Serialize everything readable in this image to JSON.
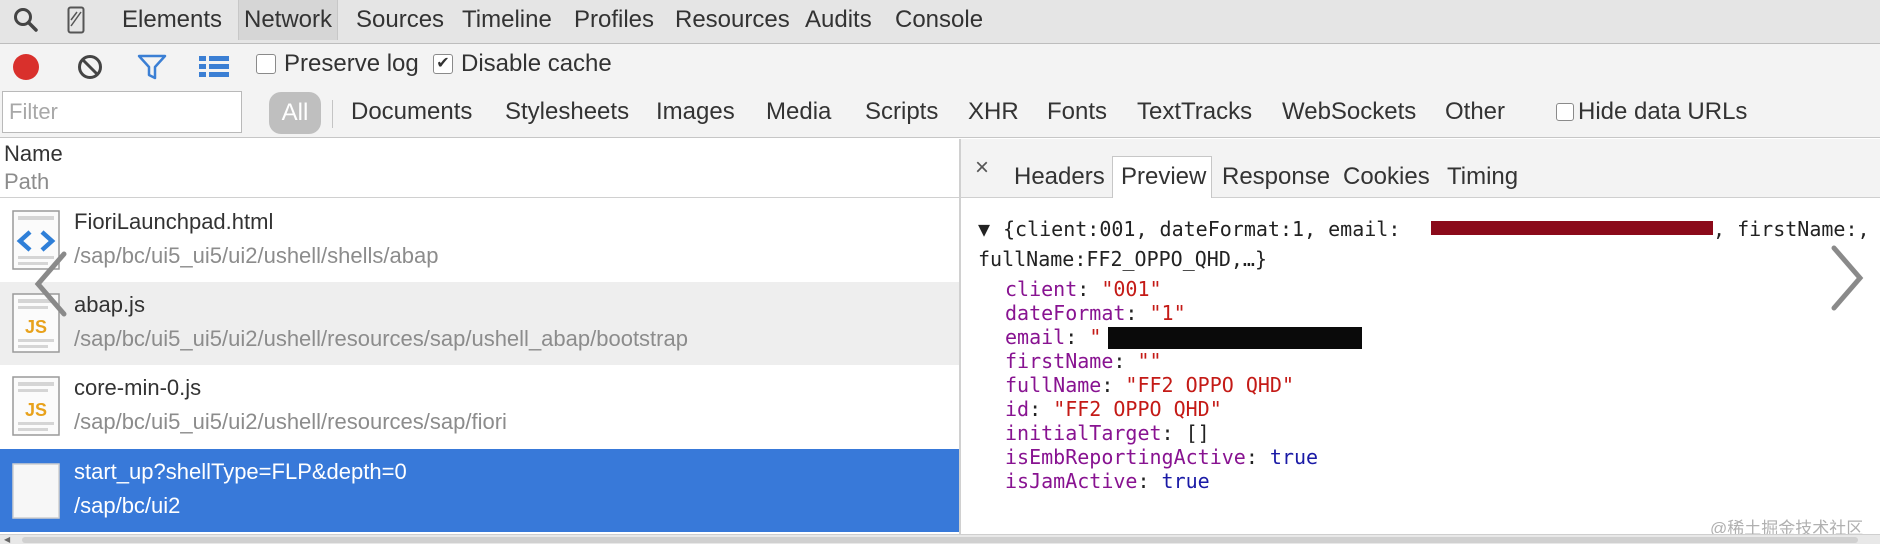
{
  "toolbar": {
    "search_icon": "search-icon",
    "device_icon": "device-mode-icon",
    "tabs": [
      "Elements",
      "Network",
      "Sources",
      "Timeline",
      "Profiles",
      "Resources",
      "Audits",
      "Console"
    ],
    "active_tab": "Network"
  },
  "network_toolbar": {
    "record_icon": "record-icon",
    "clear_icon": "clear-icon",
    "filter_icon": "filter-icon",
    "view_icon": "list-view-icon",
    "preserve_log": {
      "label": "Preserve log",
      "checked": false
    },
    "disable_cache": {
      "label": "Disable cache",
      "checked": true
    }
  },
  "filter_bar": {
    "placeholder": "Filter",
    "all_label": "All",
    "types": [
      "Documents",
      "Stylesheets",
      "Images",
      "Media",
      "Scripts",
      "XHR",
      "Fonts",
      "TextTracks",
      "WebSockets",
      "Other"
    ],
    "hide_data_urls": {
      "label": "Hide data URLs",
      "checked": false
    }
  },
  "request_list": {
    "header_name": "Name",
    "header_path": "Path",
    "rows": [
      {
        "name": "FioriLaunchpad.html",
        "path": "/sap/bc/ui5_ui5/ui2/ushell/shells/abap",
        "icon": "html-file-icon"
      },
      {
        "name": "abap.js",
        "path": "/sap/bc/ui5_ui5/ui2/ushell/resources/sap/ushell_abap/bootstrap",
        "icon": "js-file-icon"
      },
      {
        "name": "core-min-0.js",
        "path": "/sap/bc/ui5_ui5/ui2/ushell/resources/sap/fiori",
        "icon": "js-file-icon"
      },
      {
        "name": "start_up?shellType=FLP&depth=0",
        "path": "/sap/bc/ui2",
        "icon": "blank-file-icon",
        "selected": true
      }
    ]
  },
  "detail": {
    "close_label": "×",
    "tabs": [
      "Headers",
      "Preview",
      "Response",
      "Cookies",
      "Timing"
    ],
    "active_tab": "Preview",
    "preview": {
      "summary_line_1a": "{client:001, dateFormat:1, email:",
      "summary_line_1b": ", firstName:,",
      "summary_line_2": "fullName:FF2_OPPO_QHD,…}",
      "props": [
        {
          "key": "client",
          "value": "\"001\"",
          "kind": "string"
        },
        {
          "key": "dateFormat",
          "value": "\"1\"",
          "kind": "string"
        },
        {
          "key": "email",
          "value": "\"",
          "kind": "string"
        },
        {
          "key": "firstName",
          "value": "\"\"",
          "kind": "string"
        },
        {
          "key": "fullName",
          "value": "\"FF2 OPPO QHD\"",
          "kind": "string"
        },
        {
          "key": "id",
          "value": "\"FF2 OPPO QHD\"",
          "kind": "string"
        },
        {
          "key": "initialTarget",
          "value": "[]",
          "kind": "plain"
        },
        {
          "key": "isEmbReportingActive",
          "value": "true",
          "kind": "keyword"
        },
        {
          "key": "isJamActive",
          "value": "true",
          "kind": "keyword"
        }
      ]
    }
  },
  "watermark": "@稀土掘金技术社区",
  "colors": {
    "selected_row": "#3879d9",
    "record_red": "#d9302c",
    "filter_blue": "#3b7fd4",
    "json_key": "#881391",
    "json_string": "#c41a16",
    "json_keyword": "#1a1aa6"
  }
}
